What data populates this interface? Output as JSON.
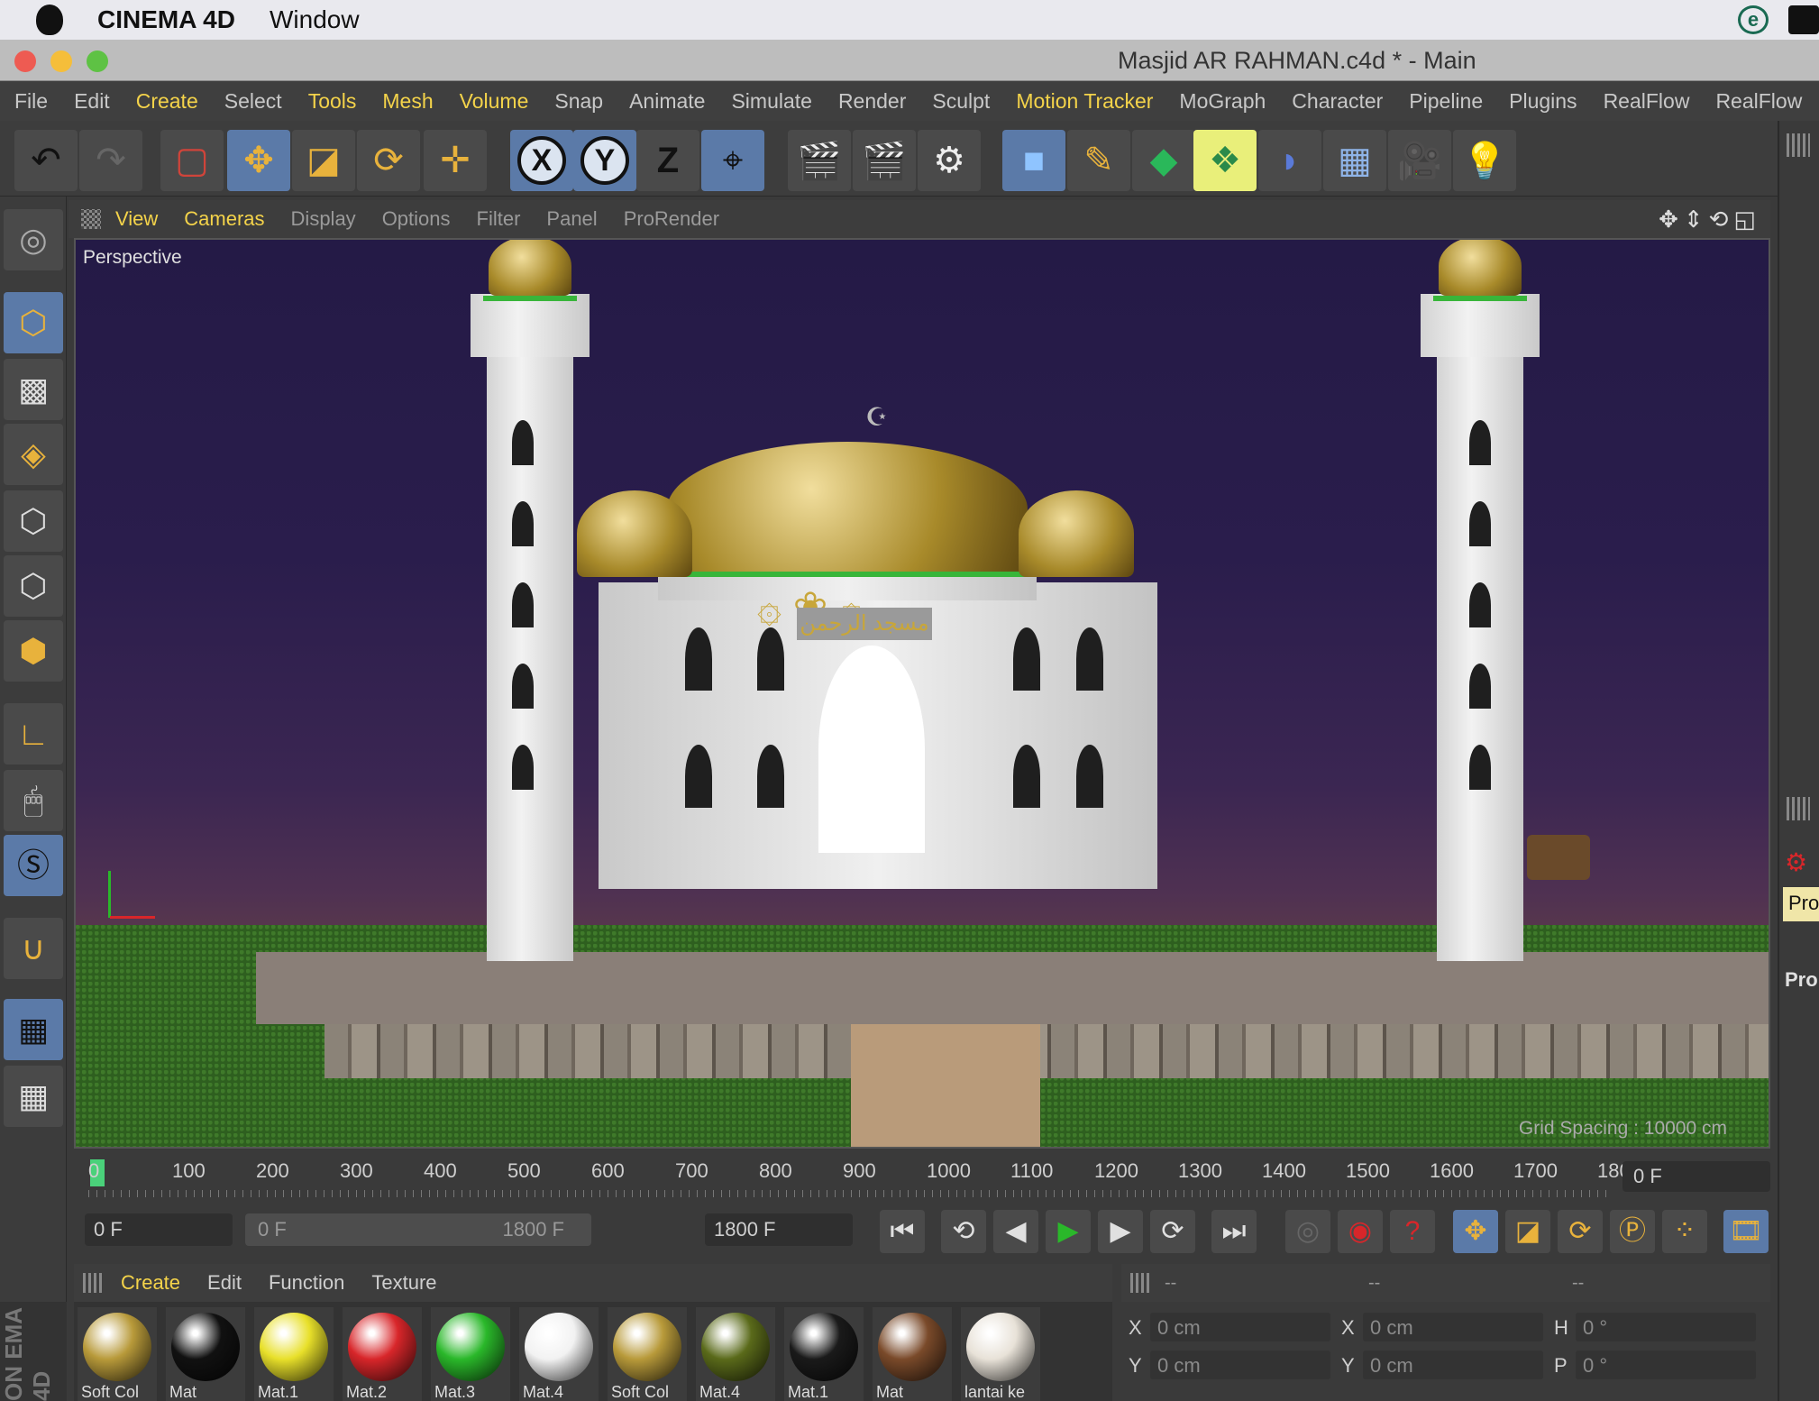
{
  "macbar": {
    "app": "CINEMA 4D",
    "window_menu": "Window"
  },
  "window": {
    "title": "Masjid AR RAHMAN.c4d * - Main"
  },
  "main_menu": [
    "File",
    "Edit",
    "Create",
    "Select",
    "Tools",
    "Mesh",
    "Volume",
    "Snap",
    "Animate",
    "Simulate",
    "Render",
    "Sculpt",
    "Motion Tracker",
    "MoGraph",
    "Character",
    "Pipeline",
    "Plugins",
    "RealFlow",
    "RealFlow"
  ],
  "main_menu_highlighted": [
    "Create",
    "Tools",
    "Mesh",
    "Volume",
    "Motion Tracker"
  ],
  "toolbar": {
    "axis_x": "X",
    "axis_y": "Y",
    "axis_z": "Z"
  },
  "viewport": {
    "menu": [
      "View",
      "Cameras",
      "Display",
      "Options",
      "Filter",
      "Panel",
      "ProRender"
    ],
    "menu_highlighted": [
      "View",
      "Cameras"
    ],
    "camera_label": "Perspective",
    "grid_spacing": "Grid Spacing : 10000 cm"
  },
  "timeline": {
    "ticks": [
      "0",
      "100",
      "200",
      "300",
      "400",
      "500",
      "600",
      "700",
      "800",
      "900",
      "1000",
      "1100",
      "1200",
      "1300",
      "1400",
      "1500",
      "1600",
      "1700",
      "180"
    ],
    "current_frame": "0 F"
  },
  "transport": {
    "start_field": "0 F",
    "range_start": "0 F",
    "range_end": "1800 F",
    "end_field": "1800 F"
  },
  "material_manager": {
    "menu": [
      "Create",
      "Edit",
      "Function",
      "Texture"
    ],
    "materials": [
      {
        "name": "Soft Col",
        "color": "#b89a3a"
      },
      {
        "name": "Mat",
        "color": "#111111"
      },
      {
        "name": "Mat.1",
        "color": "#e8e02a"
      },
      {
        "name": "Mat.2",
        "color": "#d8262a"
      },
      {
        "name": "Mat.3",
        "color": "#2ab82a"
      },
      {
        "name": "Mat.4",
        "color": "#f2f2f2"
      },
      {
        "name": "Soft Col",
        "color": "#b89a3a"
      },
      {
        "name": "Mat.4",
        "color": "#5a6a1a"
      },
      {
        "name": "Mat.1",
        "color": "#1a1a1a"
      },
      {
        "name": "Mat",
        "color": "#7a4a2a"
      },
      {
        "name": "lantai ke",
        "color": "#e8e2d8"
      }
    ]
  },
  "coordinates": {
    "headers": [
      "--",
      "--",
      "--"
    ],
    "rows": [
      {
        "l1": "X",
        "v1": "0 cm",
        "l2": "X",
        "v2": "0 cm",
        "l3": "H",
        "v3": "0 °"
      },
      {
        "l1": "Y",
        "v1": "0 cm",
        "l2": "Y",
        "v2": "0 cm",
        "l3": "P",
        "v3": "0 °"
      }
    ]
  },
  "right_panel": {
    "pro_label_1": "Pro",
    "pro_label_2": "Pro"
  },
  "cutoff_text": "ON EMA 4D",
  "mosque": {
    "inscription": "مسجد الرحمن"
  }
}
